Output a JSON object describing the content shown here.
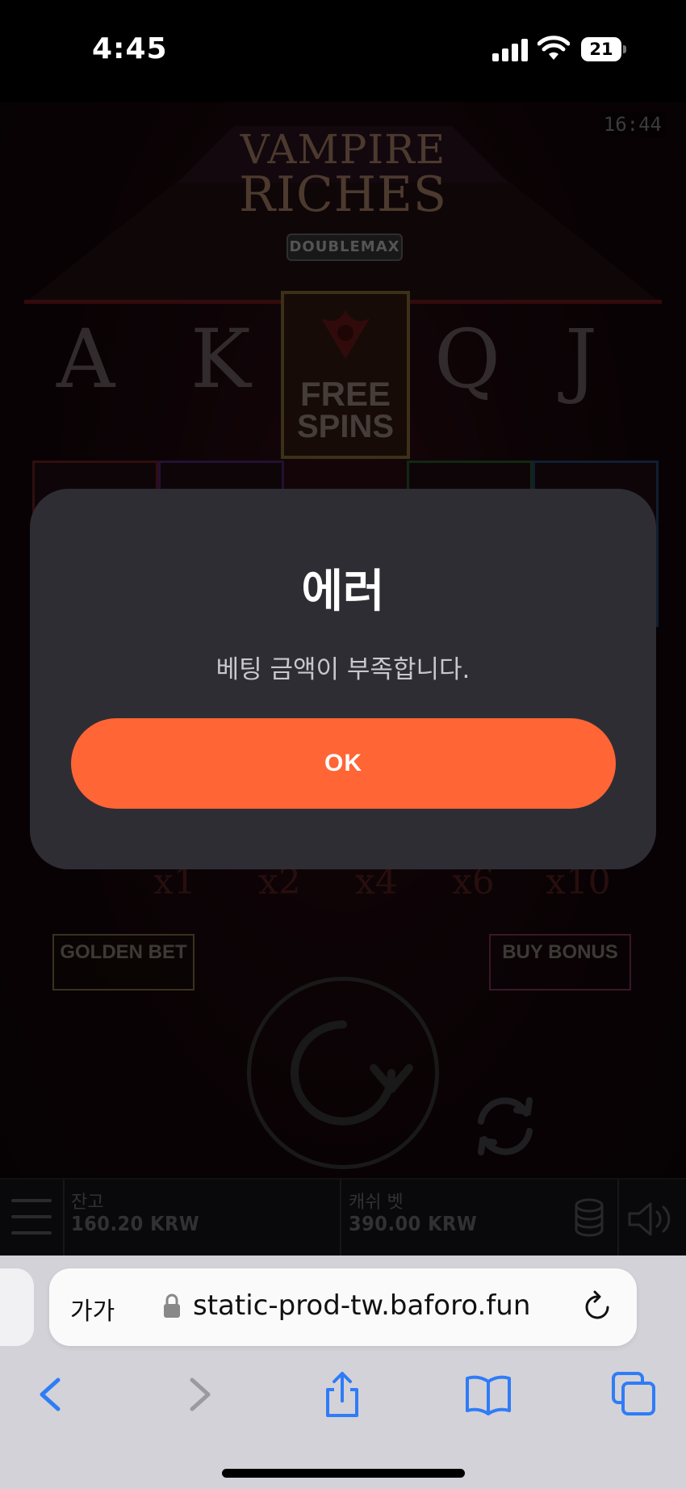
{
  "status_bar": {
    "time": "4:45",
    "battery": "21"
  },
  "game": {
    "clock": "16:44",
    "logo_line1": "VAMPIRE",
    "logo_line2": "RICHES",
    "logo_badge": "DOUBLEMAX",
    "symbols": [
      "A",
      "K",
      "Q",
      "J"
    ],
    "free_spins_line1": "FREE",
    "free_spins_line2": "SPINS",
    "multipliers": [
      "x1",
      "x2",
      "x4",
      "x6",
      "x10"
    ],
    "golden_bet_label": "GOLDEN BET",
    "buy_bonus_label": "BUY BONUS",
    "balance_label": "잔고",
    "balance_value": "160.20 KRW",
    "cash_bet_label": "캐쉬 벳",
    "cash_bet_value": "390.00 KRW"
  },
  "dialog": {
    "title": "에러",
    "message": "베팅 금액이 부족합니다.",
    "ok_label": "OK"
  },
  "safari": {
    "text_size_label": "가가",
    "url": "static-prod-tw.baforo.fun"
  },
  "colors": {
    "accent": "#ff6535",
    "dialog_bg": "#2f2d34",
    "safari_bar": "#d3d2d8",
    "ios_blue": "#2f7cf6"
  }
}
